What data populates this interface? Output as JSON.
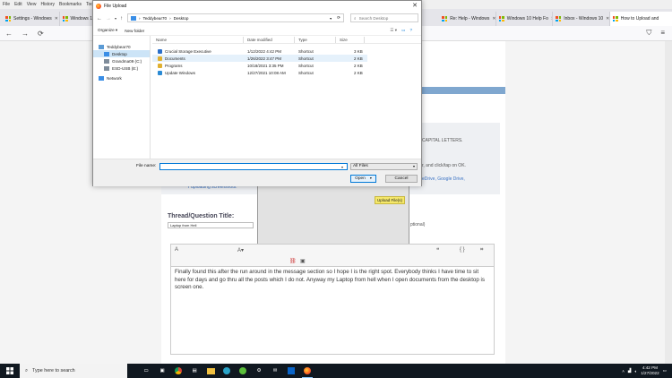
{
  "menubar": {
    "items": [
      "File",
      "Edit",
      "View",
      "History",
      "Bookmarks",
      "Tools"
    ]
  },
  "tabs": [
    {
      "label": "Settings - Windows",
      "active": false
    },
    {
      "label": "Windows 1",
      "active": false
    },
    {
      "label": "Re: Help - Windows",
      "active": false
    },
    {
      "label": "Windows 10 Help Fo",
      "active": false
    },
    {
      "label": "Inbox - Windows 10",
      "active": false
    },
    {
      "label": "How to Upload and",
      "active": true
    }
  ],
  "dialog": {
    "title": "File Upload",
    "breadcrumb": [
      "Teddybear70",
      "Desktop"
    ],
    "search_placeholder": "Search Desktop",
    "organize_label": "Organize",
    "new_folder_label": "New folder",
    "nav": [
      {
        "label": "Teddybear70",
        "icon": "user-folder-icon",
        "selected": false,
        "color": "#5b9bd5"
      },
      {
        "label": "Desktop",
        "icon": "desktop-icon",
        "selected": true,
        "color": "#3a8ee6"
      },
      {
        "label": "Grandma09 (C:)",
        "icon": "drive-icon",
        "selected": false,
        "color": "#7f8c9a"
      },
      {
        "label": "ESD-USB (E:)",
        "icon": "usb-drive-icon",
        "selected": false,
        "color": "#7f8c9a"
      },
      {
        "label": "Network",
        "icon": "network-icon",
        "selected": false,
        "color": "#3a8ee6"
      }
    ],
    "columns": {
      "name": "Name",
      "date": "Date modified",
      "type": "Type",
      "size": "Size"
    },
    "files": [
      {
        "name": "Crucial Storage Executive",
        "date": "1/12/2022 4:42 PM",
        "type": "Shortcut",
        "size": "3 KB",
        "color": "#2a6fc9",
        "selected": false
      },
      {
        "name": "Documents",
        "date": "1/26/2022 3:47 PM",
        "type": "Shortcut",
        "size": "2 KB",
        "color": "#e0b030",
        "selected": true
      },
      {
        "name": "Programs",
        "date": "10/18/2021 3:35 PM",
        "type": "Shortcut",
        "size": "2 KB",
        "color": "#e0b030",
        "selected": false
      },
      {
        "name": "Update Windows",
        "date": "12/27/2021 10:08 AM",
        "type": "Shortcut",
        "size": "2 KB",
        "color": "#2a8ad4",
        "selected": false
      }
    ],
    "file_name_label": "File name:",
    "file_name_value": "",
    "filter_value": "All Files",
    "open_label": "Open",
    "cancel_label": "Cancel"
  },
  "page": {
    "notice_capital": "CAPITAL LETTERS.",
    "notice_click": "r, and click/tap on OK.",
    "notice_links": "eDrive, Google Drive,",
    "notice_bottom": "r uploading screenshots.",
    "thread_title_label": "Thread/Question Title:",
    "thread_title_value": "Laptop from Hell",
    "optional_text": "ptional)",
    "upload_button": "Upload File(s)",
    "editor_text": "Finally found this after the run  around in the message section so I hope I is the right spot.  Everybody thinks I have time to sit here for days and go thru all the posts which I do not.  Anyway my Laptop from hell when I open documents from the desktop is screen one."
  },
  "taskbar": {
    "search_placeholder": "Type here to search",
    "time": "4:42 PM",
    "date": "1/27/2022"
  },
  "colors": {
    "accent": "#0078d7",
    "taskbar": "#101820",
    "blue_bar": "#7fa7cf",
    "upload_button": "#f5e86a"
  }
}
